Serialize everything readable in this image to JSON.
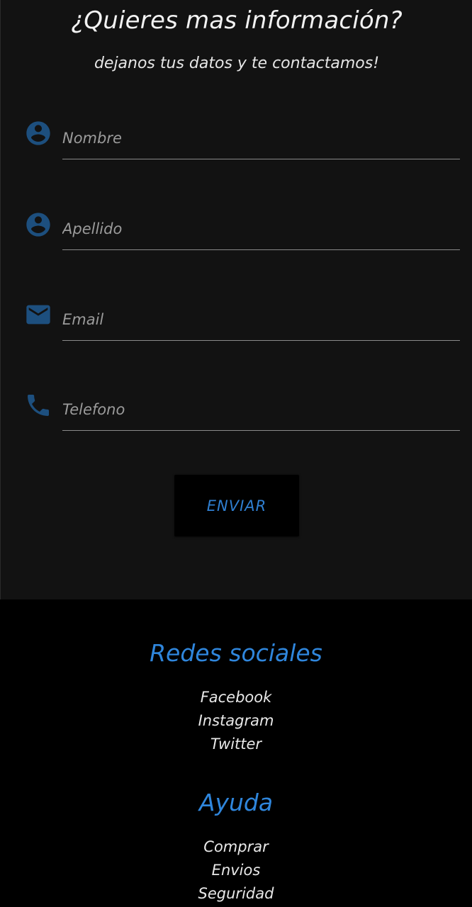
{
  "contact": {
    "title": "¿Quieres mas información?",
    "subtitle": "dejanos tus datos y te contactamos!",
    "fields": [
      {
        "placeholder": "Nombre",
        "icon": "person-icon"
      },
      {
        "placeholder": "Apellido",
        "icon": "person-icon"
      },
      {
        "placeholder": "Email",
        "icon": "email-icon"
      },
      {
        "placeholder": "Telefono",
        "icon": "phone-icon"
      }
    ],
    "submit_label": "ENVIAR"
  },
  "footer": {
    "social": {
      "heading": "Redes sociales",
      "links": [
        "Facebook",
        "Instagram",
        "Twitter"
      ]
    },
    "help": {
      "heading": "Ayuda",
      "links": [
        "Comprar",
        "Envios",
        "Seguridad"
      ]
    }
  },
  "colors": {
    "form_background": "#121212",
    "footer_background": "#000000",
    "accent": "#2f86dc",
    "icon": "#1d4f7e"
  }
}
